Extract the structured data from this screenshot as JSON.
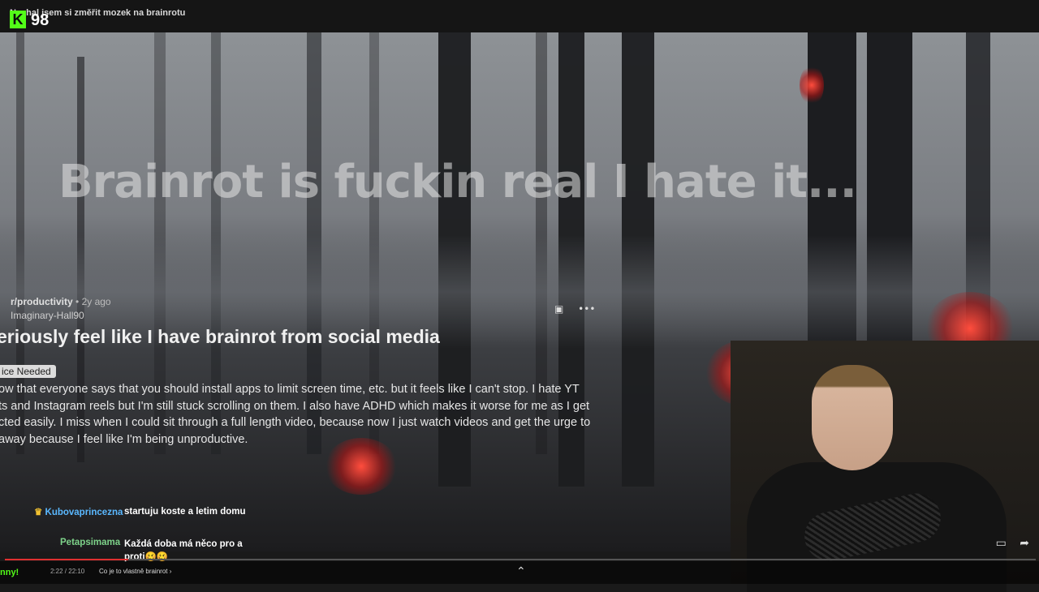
{
  "header": {
    "stream_title": "Nechal jsem si změřit mozek na brainrotu",
    "logo_glyph": "K",
    "viewer_count": "98"
  },
  "video": {
    "overlay_headline": "Brainrot is fuckin  real I hate it...",
    "post": {
      "subreddit": "r/productivity",
      "separator": "•",
      "age": "2y ago",
      "username": "Imaginary-Hall90",
      "title": "eriously feel like I have brainrot from social media",
      "flair": "ice Needed",
      "body_lines": [
        "ow that everyone says that you should install apps to limit screen time, etc. but it feels like I can't stop. I hate YT",
        "ts and Instagram reels but I'm still stuck scrolling on them. I also have ADHD which makes it worse for me as I get",
        "cted easily. I miss when I could sit through a full length video, because now I just watch videos and get the urge to",
        " away because I feel like I'm being unproductive."
      ],
      "icons": [
        "save-icon",
        "more-icon"
      ],
      "more_glyph": "•••",
      "save_glyph": "▣"
    }
  },
  "chat": {
    "messages": [
      {
        "user": "Kubovaprincezna",
        "text": "startuju koste a letim domu",
        "badge": "crown-badge-icon"
      },
      {
        "user": "Petapsimama",
        "text": "Každá doba má něco pro a proti🥴🥴"
      }
    ]
  },
  "player": {
    "progress_fraction": 0.12,
    "chapter_label": "Co je to vlastně brainrot",
    "chapter_chevron": "›",
    "up_chevron": "⌃",
    "time_text": "2:22 / 22:10",
    "left_label": "nny!"
  },
  "colors": {
    "kick_green": "#53fc18",
    "chat_user_blue": "#5ab8ff",
    "chat_user_green": "#7ed38a",
    "progress_red": "#e03030"
  }
}
